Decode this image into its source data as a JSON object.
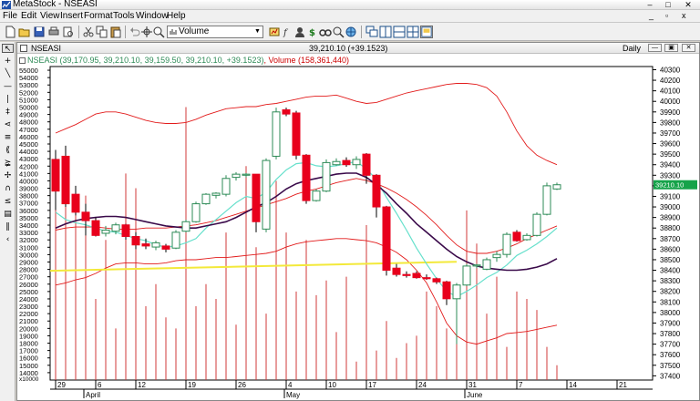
{
  "window": {
    "title": "MetaStock - NSEASI",
    "minimize": "–",
    "maximize": "□",
    "close": "✕"
  },
  "menu": {
    "items": [
      "File",
      "Edit",
      "View",
      "Insert",
      "Format",
      "Tools",
      "Window",
      "Help"
    ],
    "mdi_minimize": "_",
    "mdi_restore": "▫",
    "mdi_close": "x"
  },
  "toolbar": {
    "indicator_value": "Volume"
  },
  "chart_window": {
    "name": "NSEASI",
    "last_quote": "39,210.10 (+39.1523)",
    "periodicity": "Daily",
    "legend_security": "NSEASI (39,170.95, 39,210.10, 39,159.50, 39,210.10, +39.1523)",
    "legend_volume": ", Volume (158,361,440)",
    "legend_volume_color": "#cc0000",
    "legend_security_color": "#2e8b57"
  },
  "colors": {
    "up_candle": "#2e8b57",
    "down_candle": "#e8001c",
    "volume_bar": "#d23a3a",
    "ma_fast": "#66e0cc",
    "ma_slow": "#3a0a4a",
    "envelope": "#e21b1b",
    "trendline": "#f3e93a",
    "last_price_bg": "#16a34a"
  },
  "chart_data": {
    "type": "candlestick",
    "price_axis": {
      "ticks": [
        40300,
        40200,
        40100,
        40000,
        39900,
        39800,
        39700,
        39600,
        39500,
        39400,
        39300,
        39200,
        39100,
        39000,
        38900,
        38800,
        38700,
        38600,
        38500,
        38400,
        38300,
        38200,
        38100,
        38000,
        37900,
        37800,
        37700,
        37600,
        37500,
        37400
      ],
      "min": 37360,
      "max": 40330
    },
    "volume_axis": {
      "ticks": [
        55000,
        54000,
        53000,
        52000,
        51000,
        50000,
        49000,
        48000,
        47000,
        46000,
        45000,
        44000,
        43000,
        42000,
        41000,
        40000,
        39000,
        38000,
        37000,
        36000,
        35000,
        34000,
        33000,
        32000,
        31000,
        30000,
        29000,
        28000,
        27000,
        26000,
        25000,
        24000,
        23000,
        22000,
        21000,
        20000,
        19000,
        18000,
        17000,
        16000,
        15000,
        14000
      ],
      "bottom_label": "x10000",
      "min": 13000,
      "max": 55500
    },
    "date_axis": {
      "day_ticks": [
        {
          "label": "29",
          "idx": 0
        },
        {
          "label": "6",
          "idx": 4
        },
        {
          "label": "12",
          "idx": 8
        },
        {
          "label": "19",
          "idx": 13
        },
        {
          "label": "26",
          "idx": 18
        },
        {
          "label": "4",
          "idx": 23
        },
        {
          "label": "10",
          "idx": 27
        },
        {
          "label": "17",
          "idx": 31
        },
        {
          "label": "24",
          "idx": 36
        },
        {
          "label": "31",
          "idx": 41
        },
        {
          "label": "7",
          "idx": 46
        },
        {
          "label": "14",
          "idx": 51
        },
        {
          "label": "21",
          "idx": 56
        }
      ],
      "month_ticks": [
        {
          "label": "April",
          "idx": 3
        },
        {
          "label": "May",
          "idx": 23
        },
        {
          "label": "June",
          "idx": 41
        }
      ]
    },
    "last_price_label": "39210.10",
    "candles": [
      {
        "o": 39450,
        "h": 39540,
        "l": 38970,
        "c": 39150
      },
      {
        "o": 39480,
        "h": 39580,
        "l": 39000,
        "c": 39030
      },
      {
        "o": 39120,
        "h": 39200,
        "l": 38920,
        "c": 38950
      },
      {
        "o": 38950,
        "h": 39030,
        "l": 38730,
        "c": 38870
      },
      {
        "o": 38870,
        "h": 38900,
        "l": 38720,
        "c": 38730
      },
      {
        "o": 38750,
        "h": 38820,
        "l": 38720,
        "c": 38780
      },
      {
        "o": 38770,
        "h": 38850,
        "l": 38740,
        "c": 38830
      },
      {
        "o": 38830,
        "h": 38840,
        "l": 38690,
        "c": 38720
      },
      {
        "o": 38720,
        "h": 38760,
        "l": 38600,
        "c": 38640
      },
      {
        "o": 38650,
        "h": 38700,
        "l": 38600,
        "c": 38630
      },
      {
        "o": 38620,
        "h": 38680,
        "l": 38590,
        "c": 38660
      },
      {
        "o": 38630,
        "h": 38650,
        "l": 38570,
        "c": 38600
      },
      {
        "o": 38610,
        "h": 38780,
        "l": 38600,
        "c": 38760
      },
      {
        "o": 38770,
        "h": 38880,
        "l": 38760,
        "c": 38860
      },
      {
        "o": 38860,
        "h": 39050,
        "l": 38850,
        "c": 39030
      },
      {
        "o": 39030,
        "h": 39130,
        "l": 39020,
        "c": 39120
      },
      {
        "o": 39110,
        "h": 39140,
        "l": 39080,
        "c": 39130
      },
      {
        "o": 39120,
        "h": 39300,
        "l": 39100,
        "c": 39270
      },
      {
        "o": 39280,
        "h": 39330,
        "l": 39250,
        "c": 39310
      },
      {
        "o": 39300,
        "h": 39320,
        "l": 39280,
        "c": 39310
      },
      {
        "o": 39310,
        "h": 39310,
        "l": 38760,
        "c": 38860
      },
      {
        "o": 38790,
        "h": 39460,
        "l": 38760,
        "c": 39440
      },
      {
        "o": 39480,
        "h": 39940,
        "l": 39450,
        "c": 39900
      },
      {
        "o": 39920,
        "h": 39940,
        "l": 39860,
        "c": 39880
      },
      {
        "o": 39890,
        "h": 39910,
        "l": 39450,
        "c": 39490
      },
      {
        "o": 39490,
        "h": 39500,
        "l": 39030,
        "c": 39060
      },
      {
        "o": 39060,
        "h": 39170,
        "l": 39050,
        "c": 39150
      },
      {
        "o": 39150,
        "h": 39450,
        "l": 39140,
        "c": 39420
      },
      {
        "o": 39400,
        "h": 39460,
        "l": 39390,
        "c": 39430
      },
      {
        "o": 39440,
        "h": 39470,
        "l": 39380,
        "c": 39400
      },
      {
        "o": 39400,
        "h": 39480,
        "l": 39360,
        "c": 39450
      },
      {
        "o": 39500,
        "h": 39510,
        "l": 39220,
        "c": 39300
      },
      {
        "o": 39300,
        "h": 39310,
        "l": 38900,
        "c": 39000
      },
      {
        "o": 39000,
        "h": 39010,
        "l": 38350,
        "c": 38400
      },
      {
        "o": 38420,
        "h": 38460,
        "l": 38340,
        "c": 38360
      },
      {
        "o": 38360,
        "h": 38390,
        "l": 38330,
        "c": 38350
      },
      {
        "o": 38370,
        "h": 38390,
        "l": 38320,
        "c": 38330
      },
      {
        "o": 38330,
        "h": 38360,
        "l": 38310,
        "c": 38320
      },
      {
        "o": 38320,
        "h": 38330,
        "l": 38270,
        "c": 38290
      },
      {
        "o": 38290,
        "h": 38300,
        "l": 38070,
        "c": 38130
      },
      {
        "o": 38130,
        "h": 38280,
        "l": 37700,
        "c": 38260
      },
      {
        "o": 38260,
        "h": 38460,
        "l": 38250,
        "c": 38440
      },
      {
        "o": 38440,
        "h": 38460,
        "l": 38420,
        "c": 38450
      },
      {
        "o": 38410,
        "h": 38520,
        "l": 38400,
        "c": 38500
      },
      {
        "o": 38520,
        "h": 38580,
        "l": 38480,
        "c": 38550
      },
      {
        "o": 38550,
        "h": 38760,
        "l": 38520,
        "c": 38740
      },
      {
        "o": 38760,
        "h": 38780,
        "l": 38670,
        "c": 38680
      },
      {
        "o": 38690,
        "h": 38750,
        "l": 38680,
        "c": 38730
      },
      {
        "o": 38730,
        "h": 38950,
        "l": 38720,
        "c": 38930
      },
      {
        "o": 38930,
        "h": 39230,
        "l": 38920,
        "c": 39200
      },
      {
        "o": 39170,
        "h": 39230,
        "l": 39160,
        "c": 39210
      }
    ],
    "volume": [
      41000,
      43500,
      36000,
      38000,
      24000,
      32000,
      20000,
      41000,
      39000,
      23000,
      26000,
      21500,
      20000,
      50000,
      23000,
      26000,
      24000,
      33000,
      20500,
      42000,
      31000,
      22000,
      40000,
      33000,
      25000,
      32000,
      24500,
      26500,
      19500,
      27000,
      15500,
      34000,
      17000,
      21000,
      16000,
      18000,
      19000,
      25000,
      23000,
      20000,
      21500,
      36000,
      31500,
      22000,
      27000,
      17500,
      25000,
      24000,
      22500,
      17500,
      15000
    ],
    "ma_fast": [
      38950,
      38880,
      38850,
      38830,
      38800,
      38770,
      38760,
      38730,
      38700,
      38680,
      38640,
      38620,
      38630,
      38660,
      38700,
      38800,
      38880,
      38960,
      39040,
      39100,
      39080,
      39140,
      39260,
      39350,
      39410,
      39420,
      39390,
      39380,
      39390,
      39410,
      39430,
      39360,
      39260,
      39090,
      38940,
      38780,
      38610,
      38460,
      38320,
      38200,
      38150,
      38200,
      38260,
      38330,
      38380,
      38450,
      38540,
      38590,
      38650,
      38720,
      38800
    ],
    "ma_slow": [
      38800,
      38840,
      38870,
      38890,
      38900,
      38910,
      38910,
      38900,
      38880,
      38860,
      38840,
      38820,
      38810,
      38800,
      38800,
      38820,
      38840,
      38860,
      38900,
      38950,
      39000,
      39040,
      39100,
      39170,
      39220,
      39250,
      39270,
      39290,
      39310,
      39320,
      39320,
      39280,
      39210,
      39130,
      39030,
      38940,
      38840,
      38760,
      38680,
      38600,
      38530,
      38480,
      38440,
      38420,
      38410,
      38400,
      38400,
      38410,
      38430,
      38460,
      38510
    ],
    "envelope_upper": [
      39700,
      39740,
      39780,
      39830,
      39880,
      39900,
      39900,
      39880,
      39850,
      39820,
      39800,
      39790,
      39790,
      39800,
      39830,
      39870,
      39900,
      39930,
      39940,
      39950,
      39950,
      39970,
      39980,
      40000,
      40020,
      40040,
      40050,
      40050,
      40060,
      40030,
      40000,
      39980,
      39990,
      40020,
      40050,
      40080,
      40100,
      40120,
      40140,
      40160,
      40170,
      40170,
      40160,
      40130,
      40050,
      39900,
      39720,
      39580,
      39490,
      39440,
      39400
    ],
    "envelope_mid": [
      38780,
      38800,
      38810,
      38810,
      38810,
      38800,
      38790,
      38790,
      38790,
      38800,
      38800,
      38800,
      38810,
      38820,
      38830,
      38850,
      38870,
      38900,
      38930,
      38960,
      38990,
      39020,
      39050,
      39080,
      39120,
      39150,
      39170,
      39200,
      39230,
      39250,
      39270,
      39250,
      39220,
      39180,
      39130,
      39070,
      39000,
      38920,
      38830,
      38730,
      38640,
      38580,
      38560,
      38560,
      38580,
      38610,
      38650,
      38700,
      38740,
      38780,
      38820
    ],
    "envelope_lower": [
      38260,
      38280,
      38310,
      38330,
      38370,
      38420,
      38460,
      38470,
      38470,
      38460,
      38460,
      38470,
      38490,
      38500,
      38500,
      38510,
      38520,
      38520,
      38530,
      38540,
      38550,
      38560,
      38580,
      38620,
      38650,
      38670,
      38680,
      38690,
      38700,
      38700,
      38690,
      38680,
      38660,
      38620,
      38570,
      38500,
      38400,
      38280,
      38100,
      37900,
      37780,
      37720,
      37700,
      37730,
      37760,
      37800,
      37810,
      37820,
      37840,
      37860,
      37880
    ],
    "trendline": {
      "start_idx": 0,
      "start_price": 38395,
      "end_idx": 40,
      "end_price": 38480
    }
  }
}
